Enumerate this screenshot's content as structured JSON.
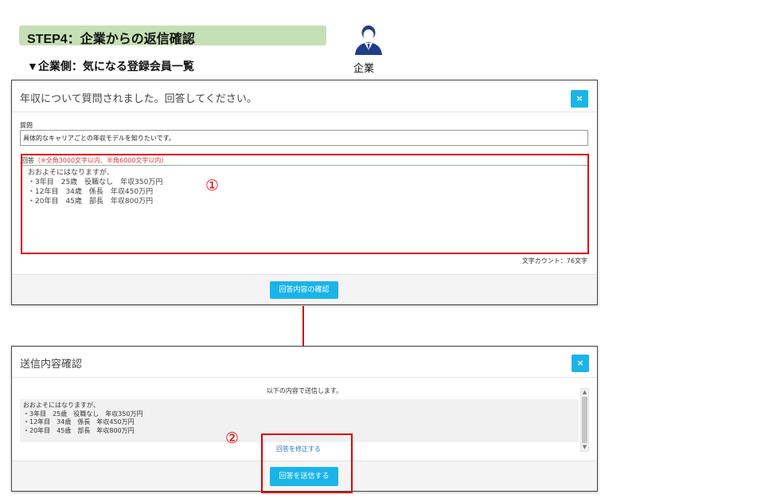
{
  "header": {
    "step_title": "STEP4：企業からの返信確認",
    "sub_heading": "▼企業側：気になる登録会員一覧",
    "company_label": "企業"
  },
  "colors": {
    "banner_green": "#c5e0b4",
    "accent_blue": "#1ab4e8",
    "highlight_red": "#e00000",
    "link_blue": "#2a7ac0"
  },
  "icons": {
    "company": "person-icon",
    "close": "close-icon",
    "scroll_up": "scroll-up-arrow-icon",
    "scroll_down": "scroll-down-arrow-icon",
    "flow_arrow": "arrow-down-icon"
  },
  "modal_answer": {
    "title": "年収について質問されました。回答してください。",
    "close_label": "×",
    "question_label": "質問",
    "question_text": "具体的なキャリアごとの年収モデルを知りたいです。",
    "answer_label": "回答",
    "answer_note": "（※全角3000文字以内、半角6000文字以内）",
    "answer_lines": [
      "おおよそにはなりますが、",
      "・3年目　25歳　役職なし　年収350万円",
      "・12年目　34歳　係長　年収450万円",
      "・20年目　45歳　部長　年収800万円"
    ],
    "char_count": "文字カウント：76文字",
    "confirm_button": "回答内容の確認"
  },
  "modal_confirm": {
    "title": "送信内容確認",
    "close_label": "×",
    "message": "以下の内容で送信します。",
    "preview_lines": [
      "おおよそにはなりますが、",
      "・3年目　25歳　役職なし　年収350万円",
      "・12年目　34歳　係長　年収450万円",
      "・20年目　45歳　部長　年収800万円"
    ],
    "edit_link": "回答を修正する",
    "send_button": "回答を送信する"
  },
  "annotations": {
    "marker_1": "①",
    "marker_2": "②"
  }
}
